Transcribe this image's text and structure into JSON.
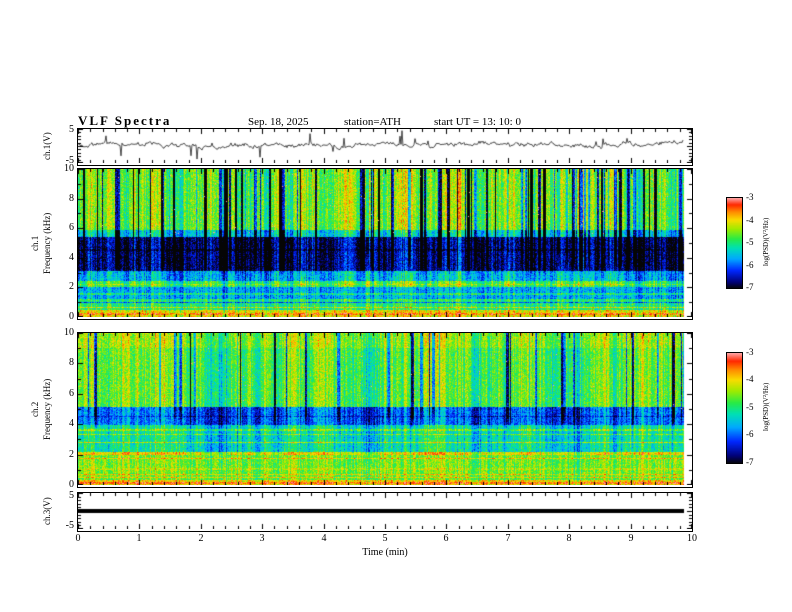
{
  "header": {
    "title": "VLF Spectra",
    "date": "Sep. 18, 2025",
    "station": "station=ATH",
    "start_ut": "start UT =  13: 10: 0"
  },
  "xaxis": {
    "label": "Time  (min)",
    "ticks": [
      "0",
      "1",
      "2",
      "3",
      "4",
      "5",
      "6",
      "7",
      "8",
      "9",
      "10"
    ]
  },
  "panels": {
    "ch1_wave": {
      "ylabel": "ch.1(V)",
      "ytick_top": "5",
      "ytick_bottom": "-5"
    },
    "ch1_spec": {
      "ylabel_channel": "ch.1",
      "ylabel_freq": "Frequency (kHz)",
      "yticks": [
        "10",
        "8",
        "6",
        "4",
        "2",
        "0"
      ]
    },
    "ch2_spec": {
      "ylabel_channel": "ch.2",
      "ylabel_freq": "Frequency (kHz)",
      "yticks": [
        "10",
        "8",
        "6",
        "4",
        "2",
        "0"
      ]
    },
    "ch3_wave": {
      "ylabel": "ch.3(V)",
      "ytick_top": "5",
      "ytick_bottom": "-5"
    }
  },
  "colorbar": {
    "label": "log(PSD)(V²/Hz)",
    "ticks": [
      "-3",
      "-4",
      "-5",
      "-6",
      "-7"
    ],
    "range": [
      -7,
      -3
    ]
  },
  "chart_data": [
    {
      "type": "line",
      "panel": "ch.1 waveform",
      "xlabel": "Time (min)",
      "ylabel": "ch.1(V)",
      "xlim": [
        0,
        10
      ],
      "ylim": [
        -5,
        5
      ],
      "yticks": [
        5,
        -5
      ],
      "description": "Noisy broadband voltage waveform fluctuating about ~+0.5 V with impulsive spikes down to ~-4.5 V and up to ~+3.5 V throughout the 10-minute record",
      "seed": 11,
      "base_offset": 0.45,
      "noise_amp": 0.85,
      "jitter": 0.55,
      "spike_prob": 0.03,
      "spike_amp": 3.2
    },
    {
      "type": "heatmap",
      "panel": "ch.1 spectrogram",
      "xlabel": "Time (min)",
      "ylabel": "Frequency (kHz)",
      "zlabel": "log(PSD)(V²/Hz)",
      "xlim": [
        0,
        10
      ],
      "flim": [
        0,
        10
      ],
      "zlim": [
        -7,
        -3
      ],
      "description": "Broadband hiss 5.9-10 kHz (~1e-4.5), quiet dark-blue band 3.1-5.4 kHz (~1e-6.6), narrowband lines below 2.5 kHz, dense dark vertical sferic streaks above ~3 kHz, scattered intense red impulses in the upper band",
      "bands": [
        [
          0,
          0.45,
          -4.0
        ],
        [
          0.45,
          1.25,
          -4.9
        ],
        [
          1.25,
          2.0,
          -5.6
        ],
        [
          2.0,
          2.45,
          -4.7
        ],
        [
          2.45,
          3.1,
          -5.5
        ],
        [
          3.1,
          5.4,
          -6.6
        ],
        [
          5.4,
          5.9,
          -5.3
        ],
        [
          5.9,
          10,
          -4.45
        ]
      ],
      "stripes": [
        [
          0.22,
          0.12,
          -3.5
        ],
        [
          0.65,
          0.09,
          -4.1
        ],
        [
          1.0,
          0.08,
          -5.9
        ],
        [
          1.55,
          0.09,
          -5.0
        ],
        [
          2.2,
          0.1,
          -4.3
        ],
        [
          4.5,
          0.14,
          -6.9
        ]
      ],
      "streaks": {
        "prob": 0.085,
        "min_f": 2.8,
        "strength": 2.1
      },
      "speckle": {
        "prob": 0.0045,
        "min_f": 5.6
      },
      "noise": 0.42,
      "col_noise": 0.55,
      "seed": 23
    },
    {
      "type": "heatmap",
      "panel": "ch.2 spectrogram",
      "xlabel": "Time (min)",
      "ylabel": "Frequency (kHz)",
      "zlabel": "log(PSD)(V²/Hz)",
      "xlim": [
        0,
        10
      ],
      "flim": [
        0,
        10
      ],
      "zlim": [
        -7,
        -3
      ],
      "description": "Green mottled hiss 5-10 kHz (~1e-4.6), blue band 4-5.1 kHz, cyan-green 2.2-3.9 kHz with thin yellow lines, strong orange/red narrowband lines below 2.1 kHz, sparse vertical sferic streaks",
      "bands": [
        [
          0,
          0.5,
          -3.9
        ],
        [
          0.5,
          1.95,
          -4.5
        ],
        [
          1.95,
          2.15,
          -4.0
        ],
        [
          2.15,
          3.95,
          -5.15
        ],
        [
          3.95,
          5.1,
          -5.9
        ],
        [
          5.1,
          9.0,
          -4.6
        ],
        [
          9.0,
          10,
          -4.35
        ]
      ],
      "stripes": [
        [
          0.15,
          0.12,
          -3.4
        ],
        [
          0.4,
          0.08,
          -4.6
        ],
        [
          0.7,
          0.08,
          -3.9
        ],
        [
          1.05,
          0.08,
          -4.2
        ],
        [
          1.75,
          0.1,
          -3.8
        ],
        [
          2.0,
          0.09,
          -3.9
        ],
        [
          2.8,
          0.08,
          -4.25
        ],
        [
          3.3,
          0.08,
          -4.45
        ],
        [
          3.62,
          0.08,
          -4.5
        ],
        [
          4.5,
          0.1,
          -6.3
        ]
      ],
      "streaks": {
        "prob": 0.05,
        "min_f": 3.5,
        "strength": 1.7
      },
      "speckle": {
        "prob": 0.002,
        "min_f": 5.0
      },
      "noise": 0.4,
      "col_noise": 0.5,
      "seed": 57
    },
    {
      "type": "line",
      "panel": "ch.3 waveform",
      "xlabel": "Time (min)",
      "ylabel": "ch.3(V)",
      "xlim": [
        0,
        10
      ],
      "ylim": [
        -5,
        5
      ],
      "yticks": [
        5,
        -5
      ],
      "description": "Flat line at 0 V (channel inactive)",
      "value": 0,
      "seed": 5
    }
  ],
  "render": {
    "data_fraction": 0.987,
    "zlim": [
      -7,
      -3
    ],
    "colormap": [
      [
        0,
        [
          5,
          5,
          5
        ]
      ],
      [
        0.07,
        [
          2,
          2,
          120
        ]
      ],
      [
        0.2,
        [
          0,
          40,
          255
        ]
      ],
      [
        0.33,
        [
          0,
          170,
          255
        ]
      ],
      [
        0.45,
        [
          0,
          225,
          180
        ]
      ],
      [
        0.55,
        [
          40,
          235,
          70
        ]
      ],
      [
        0.66,
        [
          160,
          235,
          0
        ]
      ],
      [
        0.76,
        [
          250,
          220,
          0
        ]
      ],
      [
        0.85,
        [
          255,
          140,
          0
        ]
      ],
      [
        0.93,
        [
          255,
          40,
          0
        ]
      ],
      [
        1,
        [
          255,
          160,
          160
        ]
      ]
    ]
  }
}
